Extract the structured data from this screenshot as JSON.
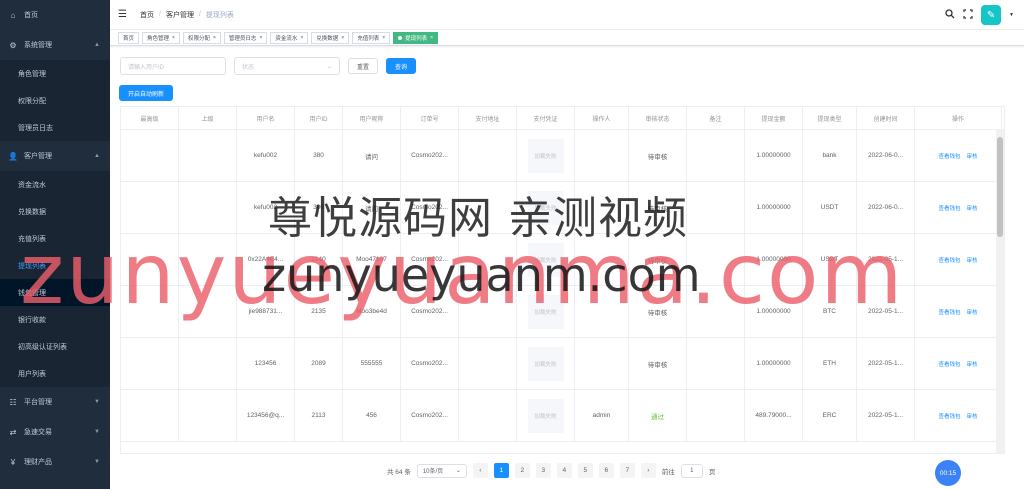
{
  "sidebar": {
    "menus": [
      {
        "icon": "⌂",
        "label": "首页",
        "has_sub": false
      },
      {
        "icon": "⚙",
        "label": "系统管理",
        "has_sub": true,
        "open": true,
        "items": [
          "角色管理",
          "权限分配",
          "管理员日志"
        ]
      },
      {
        "icon": "👤",
        "label": "客户管理",
        "has_sub": true,
        "open": true,
        "items": [
          "资金流水",
          "兑换数据",
          "充值列表",
          "提现列表",
          "钱包管理",
          "银行收款",
          "初高级认证列表",
          "用户列表"
        ]
      },
      {
        "icon": "☷",
        "label": "平台管理",
        "has_sub": true
      },
      {
        "icon": "⇄",
        "label": "急速交易",
        "has_sub": true
      },
      {
        "icon": "¥",
        "label": "理财产品",
        "has_sub": true
      }
    ],
    "active_item": "提现列表",
    "hover_item": "钱包管理"
  },
  "breadcrumb": [
    "首页",
    "客户管理",
    "提现列表"
  ],
  "tags": [
    "首页",
    "角色管理",
    "权限分配",
    "管理员日志",
    "资金流水",
    "兑换数据",
    "充值列表"
  ],
  "active_tag": "提现列表",
  "filter": {
    "user_placeholder": "请输入用户ID",
    "status_placeholder": "状态",
    "reset_label": "重置",
    "search_label": "查询"
  },
  "auto_refresh_label": "开启自动刷新",
  "table": {
    "headers": [
      "最高级",
      "上级",
      "用户名",
      "用户ID",
      "用户昵称",
      "订单号",
      "支付地址",
      "支付凭证",
      "操作人",
      "审核状态",
      "备注",
      "提现金额",
      "提现类型",
      "创建时间",
      "操作"
    ],
    "rows": [
      {
        "username": "kefu002",
        "uid": "380",
        "nick": "请问",
        "order": "Cosmo202...",
        "voucher": "加载失败",
        "operator": "",
        "status": "待审核",
        "amount": "1.00000000",
        "type": "bank",
        "time": "2022-06-0..."
      },
      {
        "username": "kefu002",
        "uid": "380",
        "nick": "请问",
        "order": "Cosmo202...",
        "voucher": "加载失败",
        "operator": "",
        "status": "待审核",
        "amount": "1.00000000",
        "type": "USDT",
        "time": "2022-06-0..."
      },
      {
        "username": "0x22A4E4...",
        "uid": "2140",
        "nick": "Moo47107",
        "order": "Cosmo202...",
        "voucher": "加载失败",
        "operator": "",
        "status": "待审核",
        "amount": "1.00000000",
        "type": "USDT",
        "time": "2022-05-1..."
      },
      {
        "username": "jie988731...",
        "uid": "2135",
        "nick": "Moo3be4d",
        "order": "Cosmo202...",
        "voucher": "加载失败",
        "operator": "",
        "status": "待审核",
        "amount": "1.00000000",
        "type": "BTC",
        "time": "2022-05-1..."
      },
      {
        "username": "123456",
        "uid": "2089",
        "nick": "555555",
        "order": "Cosmo202...",
        "voucher": "加载失败",
        "operator": "",
        "status": "待审核",
        "amount": "1.00000000",
        "type": "ETH",
        "time": "2022-05-1..."
      },
      {
        "username": "123456@q...",
        "uid": "2113",
        "nick": "456",
        "order": "Cosmo202...",
        "voucher": "加载失败",
        "operator": "admin",
        "status": "通过",
        "amount": "489.79000...",
        "type": "ERC",
        "time": "2022-05-1..."
      }
    ],
    "op_view_wallet": "查看钱包",
    "op_review": "审核"
  },
  "pager": {
    "total_text": "共 64 条",
    "page_size": "10条/页",
    "pages": [
      "1",
      "2",
      "3",
      "4",
      "5",
      "6",
      "7"
    ],
    "current": "1",
    "goto_label": "前往",
    "goto_value": "1",
    "page_unit": "页"
  },
  "timer": "00:15",
  "watermark": {
    "line1": "尊悦源码网 亲测视频",
    "line2": "zunyueyuanma.com",
    "line3": "zunyueyuanm.com"
  },
  "colors": {
    "sidebar_bg": "#1f2d3d",
    "primary": "#1890ff",
    "tag_active": "#42b983",
    "pass": "#67c23a"
  }
}
